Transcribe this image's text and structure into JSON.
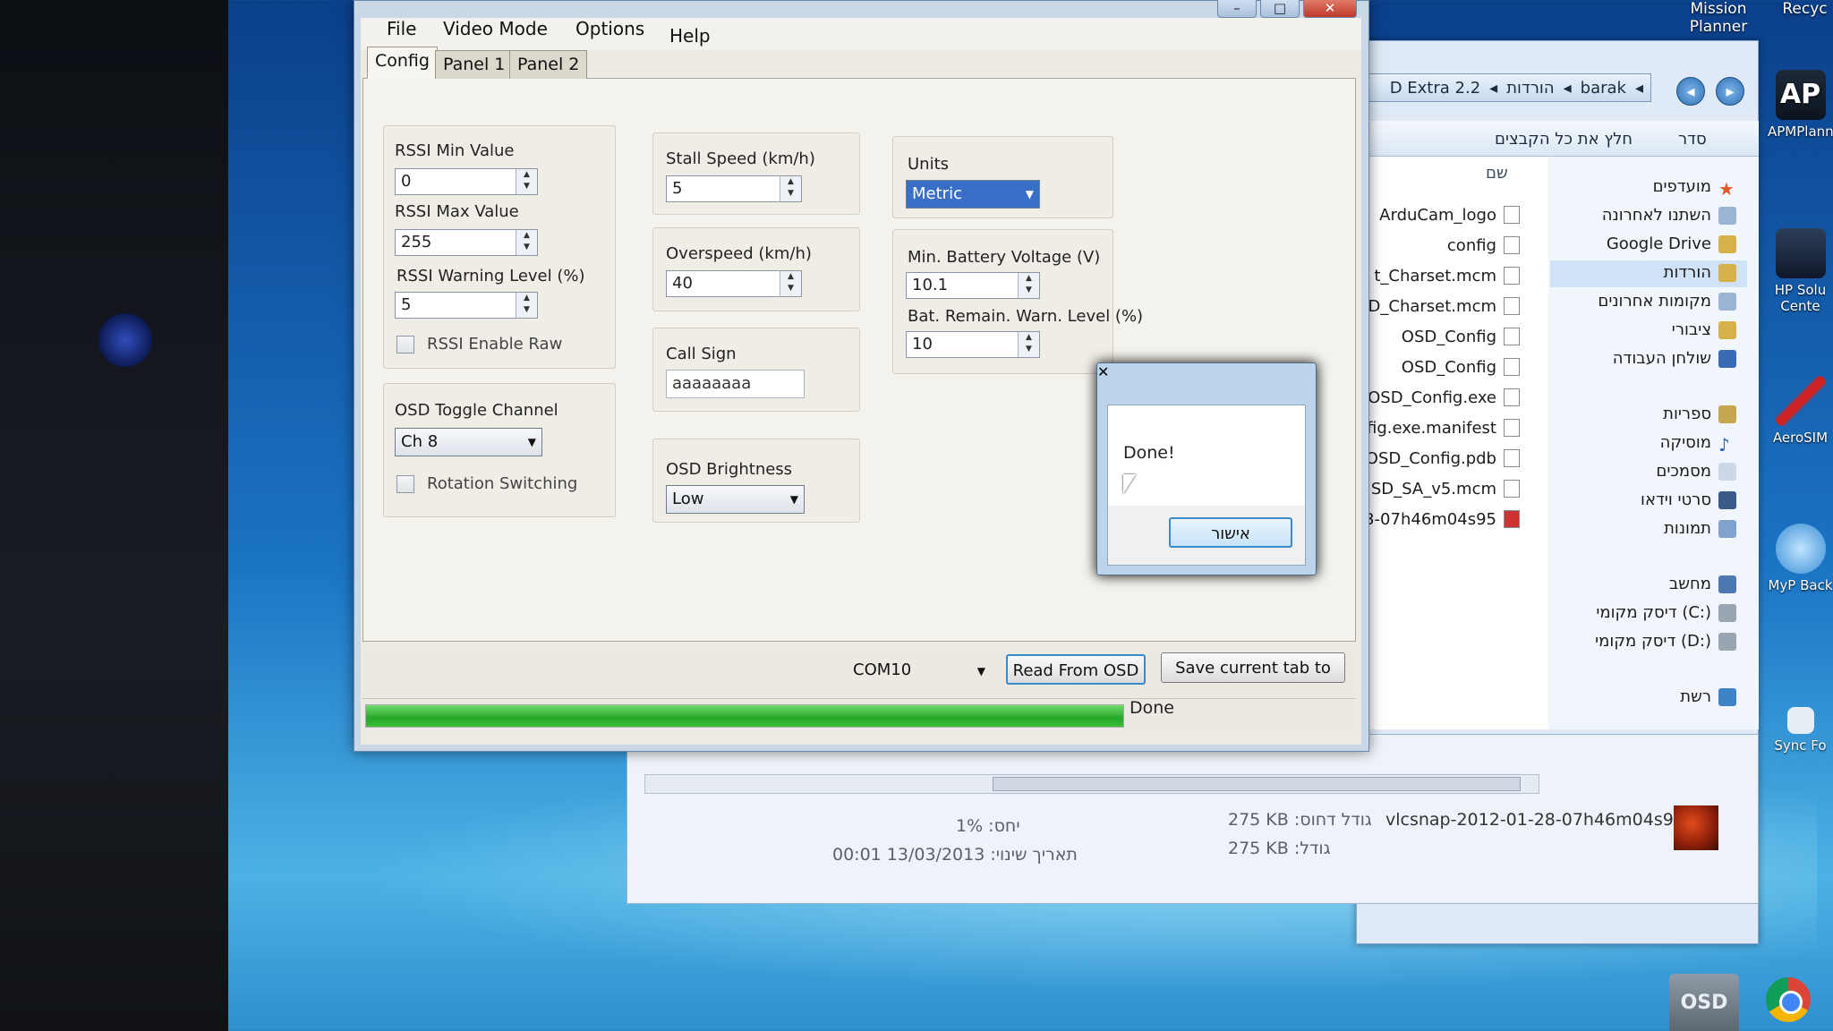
{
  "osd_window": {
    "menu": [
      "File",
      "Video Mode",
      "Options",
      "Help"
    ],
    "tabs": [
      "Config",
      "Panel 1",
      "Panel 2"
    ],
    "rssi_min_label": "RSSI Min Value",
    "rssi_min_value": "0",
    "rssi_max_label": "RSSI Max Value",
    "rssi_max_value": "255",
    "rssi_warn_label": "RSSI Warning Level (%)",
    "rssi_warn_value": "5",
    "rssi_raw_label": "RSSI Enable Raw",
    "toggle_label": "OSD Toggle Channel",
    "toggle_value": "Ch 8",
    "rotation_label": "Rotation Switching",
    "stall_label": "Stall Speed (km/h)",
    "stall_value": "5",
    "overspeed_label": "Overspeed (km/h)",
    "overspeed_value": "40",
    "callsign_label": "Call Sign",
    "callsign_value": "aaaaaaaa",
    "brightness_label": "OSD Brightness",
    "brightness_value": "Low",
    "units_label": "Units",
    "units_value": "Metric",
    "minbat_label": "Min. Battery Voltage (V)",
    "minbat_value": "10.1",
    "batwarn_label": "Bat. Remain. Warn. Level (%)",
    "batwarn_value": "10",
    "com_port": "COM10",
    "read_button": "Read From OSD",
    "save_button": "Save current tab to",
    "status_text": "Done",
    "progress_fraction": 1.0
  },
  "message_box": {
    "text": "Done!",
    "ok_button": "אישור",
    "close_glyph": "✕"
  },
  "explorer": {
    "breadcrumb": [
      "D Extra 2.2",
      "הורדות",
      "barak"
    ],
    "cmd_share": "חלץ את כל הקבצים",
    "cmd_organize": "סדר",
    "column_name": "שם",
    "files": [
      "ArduCam_logo",
      "config",
      "t_Charset.mcm",
      "D_Charset.mcm",
      "OSD_Config",
      "OSD_Config",
      "OSD_Config.exe",
      "fig.exe.manifest",
      "OSD_Config.pdb",
      "SD_SA_v5.mcm",
      "3-07h46m04s95"
    ],
    "nav": [
      "מועדפים",
      "השתנו לאחרונה",
      "Google Drive",
      "הורדות",
      "מקומות אחרונים",
      "ציבורי",
      "שולחן העבודה",
      "ספריות",
      "מוסיקה",
      "מסמכים",
      "סרטי וידאו",
      "תמונות",
      "מחשב",
      "דיסק מקומי (C:)",
      "דיסק מקומי (D:)",
      "רשת"
    ],
    "detail_filename": "vlcsnap-2012-01-28-07h46m04s95",
    "detail_size_disk": "275 KB :גודל דחוס",
    "detail_size": "275 KB :גודל",
    "detail_ratio": "1% :יחס",
    "detail_date": "00:01 13/03/2013 :תאריך שינוי"
  },
  "desktop_icons": [
    "APMPlann",
    "HP Solu Cente",
    "AeroSIM",
    "MyP Back",
    "Sync Fo"
  ],
  "top_right": [
    "Mission Planner",
    "Recyc"
  ],
  "taskbar_osd": "OSD"
}
